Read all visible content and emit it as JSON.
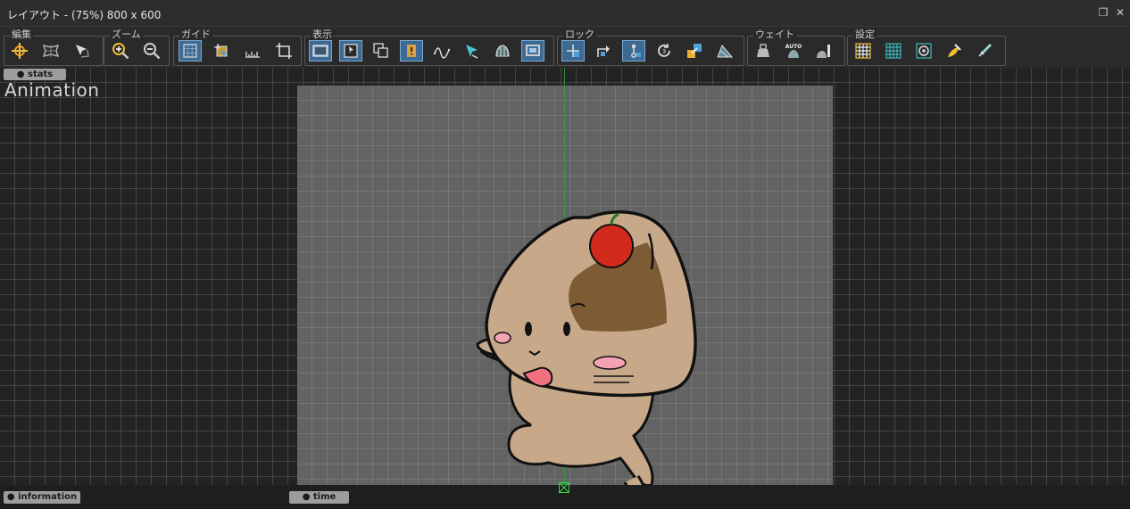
{
  "window": {
    "title": "レイアウト - (75%) 800 x 600",
    "restore_icon": "restore-icon",
    "close_icon": "close-icon"
  },
  "toolbar": {
    "groups": [
      {
        "label": "編集",
        "tools": [
          "move-icon",
          "mesh-edit-icon",
          "select-arrow-icon"
        ]
      },
      {
        "label": "ズーム",
        "tools": [
          "zoom-in-icon",
          "zoom-out-icon"
        ]
      },
      {
        "label": "ガイド",
        "tools": [
          "grid-guide-icon",
          "snap-icon",
          "ruler-icon",
          "crop-frame-icon"
        ]
      },
      {
        "label": "表示",
        "tools": [
          "view-frame-icon",
          "view-image-icon",
          "overlap-icon",
          "warning-icon",
          "curve-icon",
          "pointer-icon",
          "bell-icon",
          "screen-icon"
        ]
      },
      {
        "label": "ロック",
        "tools": [
          "lock-move-icon",
          "lock-rotate-icon",
          "lock-joint-icon",
          "lock-reset-icon",
          "lock-scale-icon",
          "lock-layer-icon"
        ]
      },
      {
        "label": "ウェイト",
        "tools": [
          "weight-icon",
          "auto-weight-icon",
          "weight-brush-icon"
        ]
      },
      {
        "label": "設定",
        "tools": [
          "grid-settings-icon",
          "grid-teal-icon",
          "target-settings-icon",
          "paint-icon",
          "sword-icon"
        ]
      }
    ],
    "auto_text": "AUTO"
  },
  "canvas": {
    "stats_label": "● stats",
    "animation_label": "Animation",
    "character_description": "cat-mascot"
  },
  "bottom": {
    "information_label": "● information",
    "time_label": "● time"
  },
  "colors": {
    "accent_active": "#3d6a93",
    "guide_green": "#2fa83a",
    "stage_gray": "#636363"
  }
}
